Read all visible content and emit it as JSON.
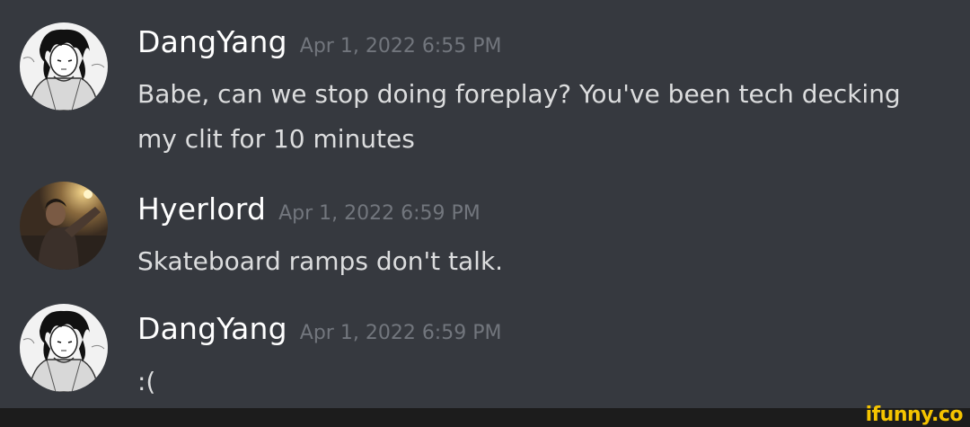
{
  "messages": [
    {
      "username": "DangYang",
      "timestamp": "Apr 1, 2022 6:55 PM",
      "lines": [
        "Babe, can we stop doing foreplay? You've been tech decking",
        "my clit for 10 minutes"
      ],
      "avatar": "anime-avatar"
    },
    {
      "username": "Hyerlord",
      "timestamp": "Apr 1, 2022 6:59 PM",
      "lines": [
        "Skateboard ramps don't talk."
      ],
      "avatar": "photo-avatar"
    },
    {
      "username": "DangYang",
      "timestamp": "Apr 1, 2022 6:59 PM",
      "lines": [
        ":("
      ],
      "avatar": "anime-avatar"
    }
  ],
  "watermark": "ifunny.co",
  "colors": {
    "background": "#36393f",
    "username": "#ffffff",
    "timestamp": "#72767d",
    "message_text": "#dcddde",
    "watermark": "#f5c400"
  }
}
